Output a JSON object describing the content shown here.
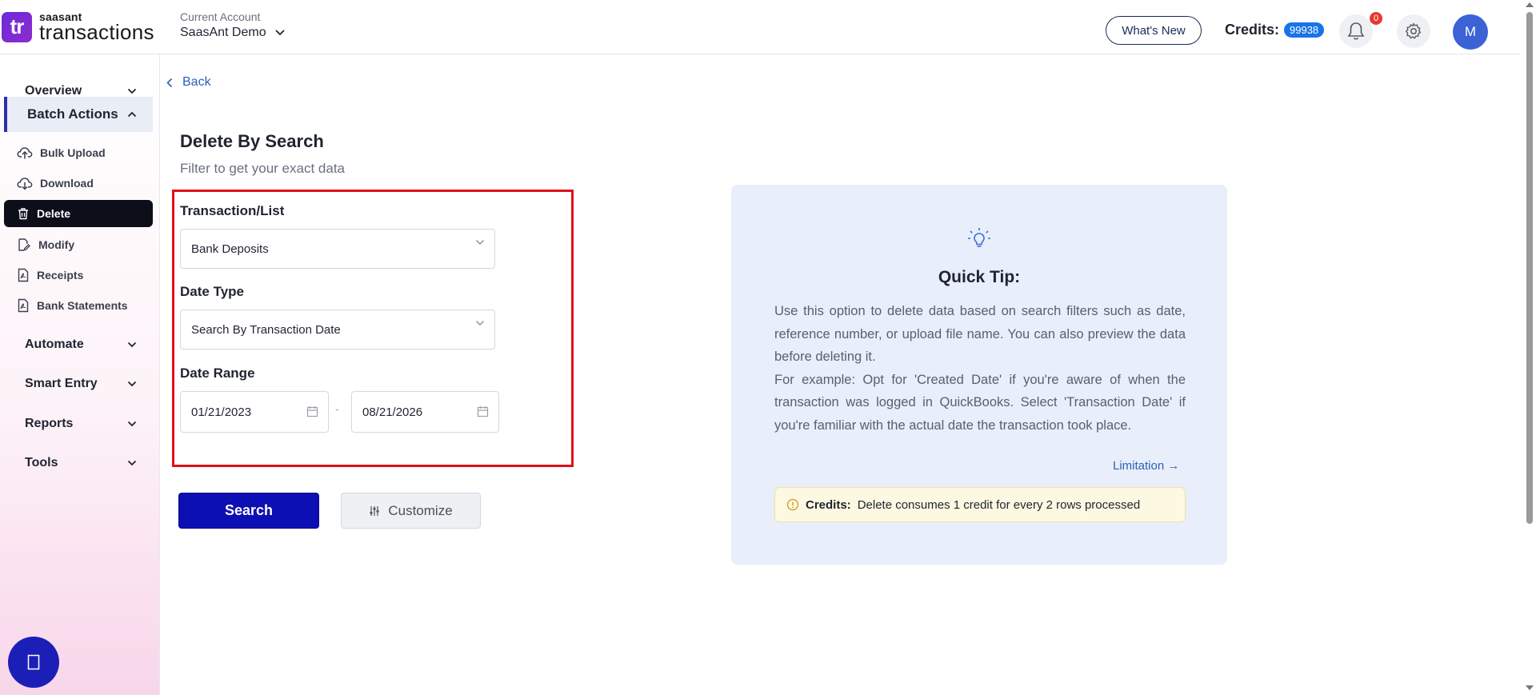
{
  "header": {
    "logo_small": "saasant",
    "logo_big": "transactions",
    "logo_mark": "tr",
    "account_caption": "Current Account",
    "account_name": "SaasAnt Demo",
    "whats_new": "What's New",
    "credits_label": "Credits:",
    "credits_value": "99938",
    "notifications_count": "0",
    "avatar_initial": "M"
  },
  "sidebar": {
    "overview": "Overview",
    "batch_actions": "Batch Actions",
    "items": [
      "Bulk Upload",
      "Download",
      "Delete",
      "Modify",
      "Receipts",
      "Bank Statements"
    ],
    "automate": "Automate",
    "smart_entry": "Smart Entry",
    "reports": "Reports",
    "tools": "Tools"
  },
  "main": {
    "back": "Back",
    "title": "Delete By Search",
    "subtitle": "Filter to get your exact data",
    "transaction_label": "Transaction/List",
    "transaction_value": "Bank Deposits",
    "date_type_label": "Date Type",
    "date_type_value": "Search By Transaction Date",
    "date_range_label": "Date Range",
    "date_from": "01/21/2023",
    "date_sep": "-",
    "date_to": "08/21/2026",
    "search_button": "Search",
    "customize_button": "Customize"
  },
  "tip": {
    "title": "Quick Tip:",
    "para1": "Use this option to delete data based on search filters such as date, reference number, or upload file name. You can also preview the data before deleting it.",
    "para2": "For example: Opt for 'Created Date' if you're aware of when the transaction was logged in QuickBooks. Select 'Transaction Date' if you're familiar with the actual date the transaction took place.",
    "limitation": "Limitation →",
    "credits_bold": "Credits:",
    "credits_text": "Delete consumes 1 credit for every 2 rows processed"
  },
  "colors": {
    "primary": "#0c0fb3",
    "highlight": "#e0101a",
    "tip_bg": "#e8eefa"
  }
}
